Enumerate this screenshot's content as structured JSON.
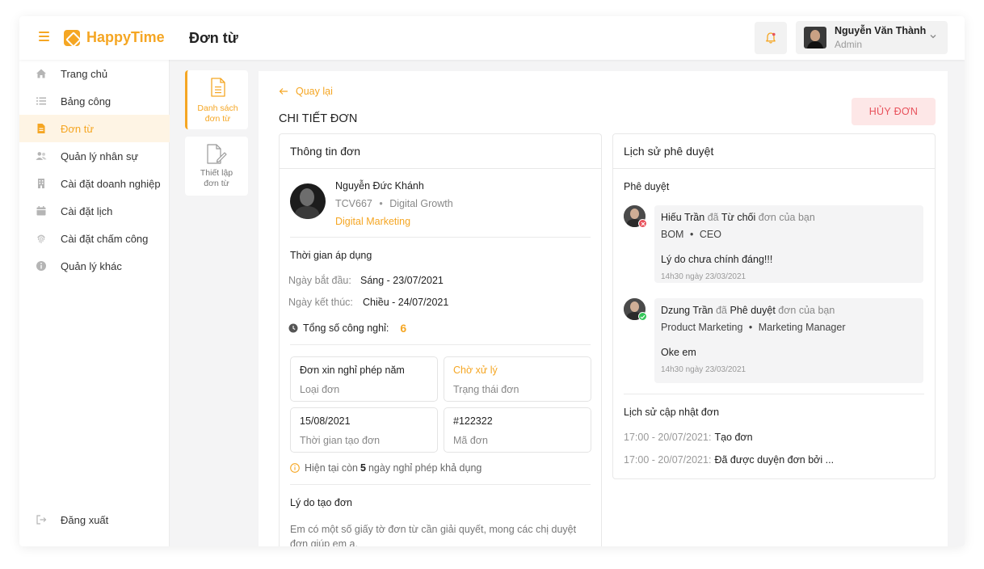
{
  "header": {
    "app_name": "HappyTime",
    "page_title": "Đơn từ",
    "user_name": "Nguyễn Văn Thành",
    "user_role": "Admin"
  },
  "sidebar": {
    "items": [
      {
        "label": "Trang chủ",
        "icon": "home-icon"
      },
      {
        "label": "Bảng công",
        "icon": "list-icon"
      },
      {
        "label": "Đơn từ",
        "icon": "document-icon",
        "active": true
      },
      {
        "label": "Quản lý nhân sự",
        "icon": "users-icon"
      },
      {
        "label": "Cài đặt doanh nghiệp",
        "icon": "building-icon"
      },
      {
        "label": "Cài đặt lịch",
        "icon": "calendar-icon"
      },
      {
        "label": "Cài đặt chấm công",
        "icon": "fingerprint-icon"
      },
      {
        "label": "Quản lý khác",
        "icon": "info-icon"
      }
    ],
    "logout_label": "Đăng xuất"
  },
  "subnav": {
    "items": [
      {
        "label_line1": "Danh sách",
        "label_line2": "đơn từ",
        "active": true
      },
      {
        "label_line1": "Thiết lập",
        "label_line2": "đơn từ",
        "active": false
      }
    ]
  },
  "content": {
    "back_label": "Quay lại",
    "title": "CHI TIẾT ĐƠN",
    "cancel_label": "HỦY ĐƠN"
  },
  "form_info": {
    "heading": "Thông tin đơn",
    "employee": {
      "name": "Nguyễn Đức Khánh",
      "code": "TCV667",
      "team": "Digital Growth",
      "department": "Digital Marketing"
    },
    "period_title": "Thời gian áp dụng",
    "start_label": "Ngày bắt đầu:",
    "start_value": "Sáng - 23/07/2021",
    "end_label": "Ngày kết thúc:",
    "end_value": "Chiều - 24/07/2021",
    "total_label": "Tổng số công nghỉ:",
    "total_value": "6",
    "cards": [
      {
        "value": "Đơn xin nghỉ phép năm",
        "key": "Loại đơn"
      },
      {
        "value": "Chờ xử lý",
        "key": "Trạng thái đơn"
      },
      {
        "value": "15/08/2021",
        "key": "Thời gian tạo đơn"
      },
      {
        "value": "#122322",
        "key": "Mã đơn"
      }
    ],
    "note_prefix": "Hiện tại còn",
    "note_count": "5",
    "note_suffix": "ngày nghỉ phép khả dụng",
    "reason_title": "Lý do tạo đơn",
    "reason_text": "Em có một số giấy tờ đơn từ cần giải quyết, mong các chị duyệt đơn giúp em ạ."
  },
  "approval": {
    "heading": "Lịch sử phê duyệt",
    "section_title": "Phê duyệt",
    "entries": [
      {
        "name": "Hiếu Trần",
        "verb": "đã",
        "action": "Từ chối",
        "suffix": "đơn của bạn",
        "dept": "BOM",
        "position": "CEO",
        "comment": "Lý do chưa chính đáng!!!",
        "time": "14h30 ngày 23/03/2021",
        "status_color": "#e8515b"
      },
      {
        "name": "Dzung Trần",
        "verb": "đã",
        "action": "Phê duyệt",
        "suffix": "đơn của bạn",
        "dept": "Product Marketing",
        "position": "Marketing Manager",
        "comment": "Oke em",
        "time": "14h30 ngày 23/03/2021",
        "status_color": "#34c759"
      }
    ],
    "history_title": "Lịch sử cập nhật đơn",
    "history": [
      {
        "time": "17:00 - 20/07/2021:",
        "action": "Tạo đơn"
      },
      {
        "time": "17:00 - 20/07/2021:",
        "action": "Đã được duyện đơn bởi ..."
      }
    ]
  },
  "colors": {
    "accent": "#f5a623",
    "danger": "#e8515b",
    "success": "#34c759"
  }
}
